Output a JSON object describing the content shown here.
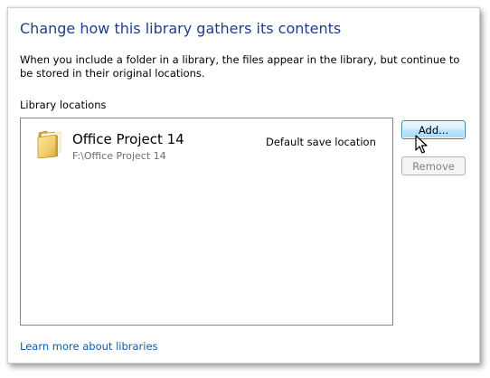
{
  "dialog": {
    "title": "Change how this library gathers its contents",
    "description": "When you include a folder in a library, the files appear in the library, but continue to be stored in their original locations.",
    "locations_label": "Library locations",
    "learn_more_link": "Learn more about libraries"
  },
  "locations": [
    {
      "name": "Office Project 14",
      "path": "F:\\Office Project 14",
      "status": "Default save location",
      "icon": "folder-icon"
    }
  ],
  "buttons": {
    "add_label": "Add...",
    "remove_label": "Remove",
    "remove_enabled": false
  },
  "colors": {
    "title": "#1e3d8f",
    "link": "#0a5db3",
    "folder": "#e8c060",
    "button_hover": "#bee6fd"
  }
}
